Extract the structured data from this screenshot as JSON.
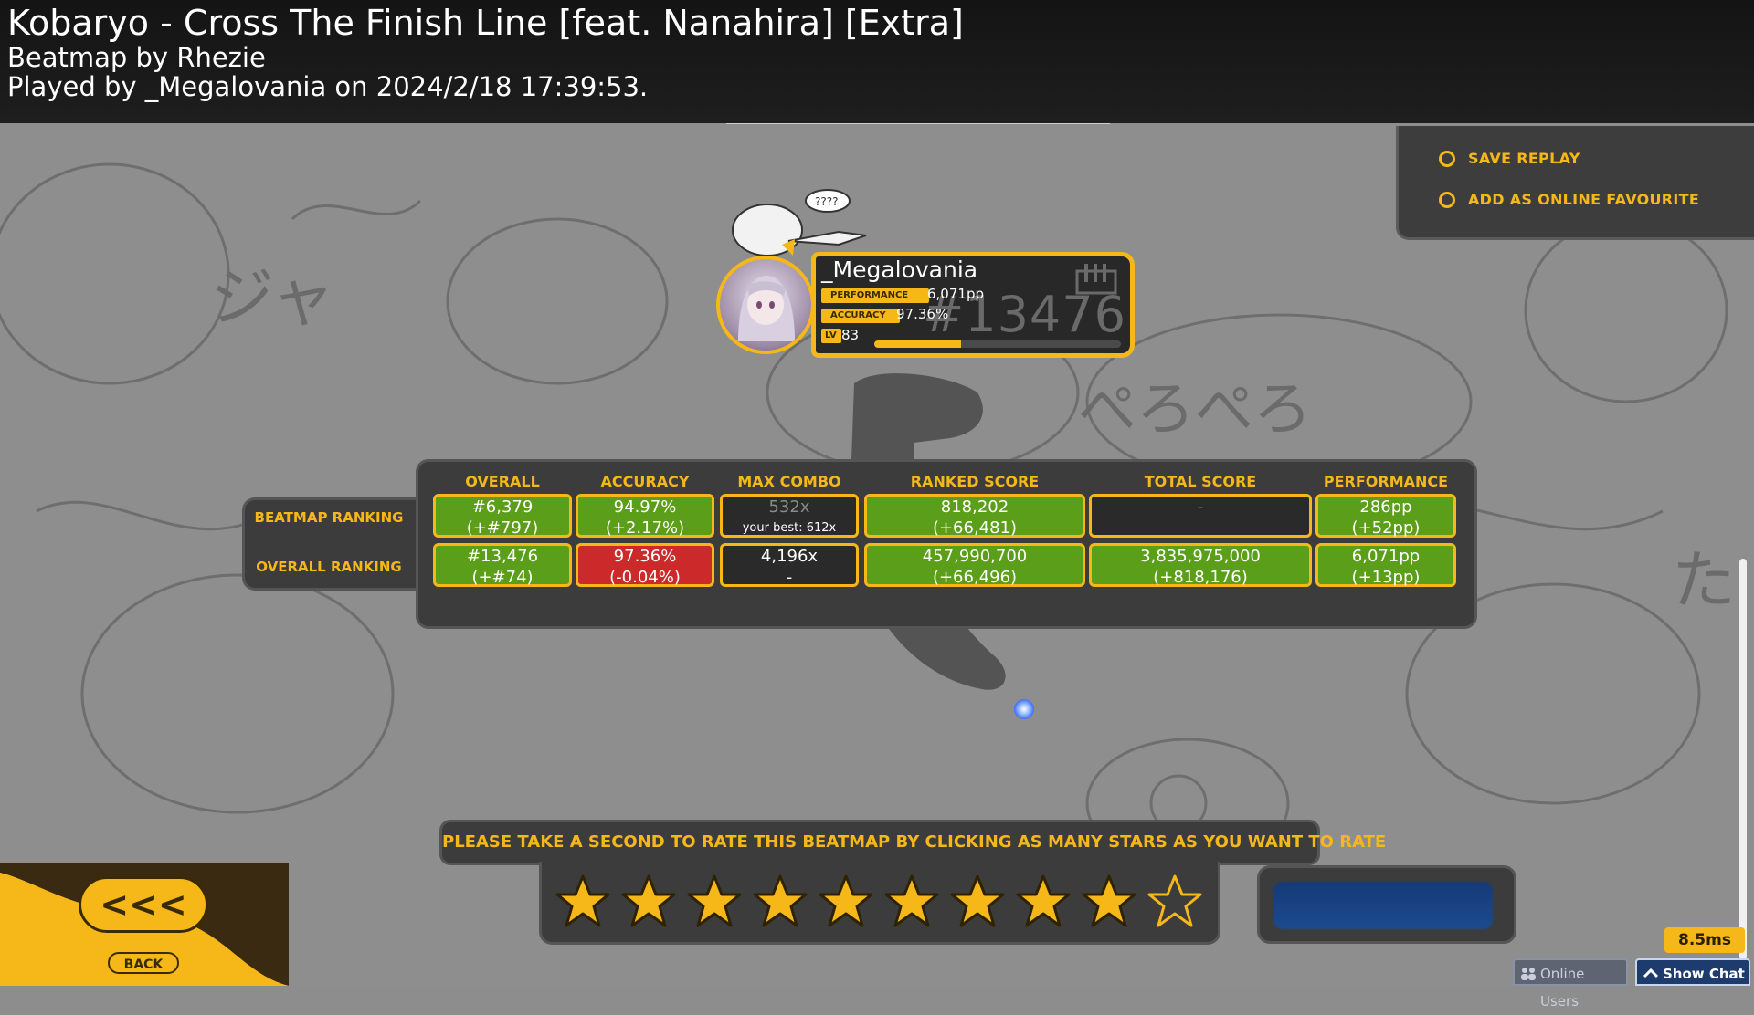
{
  "header": {
    "title": "Kobaryo - Cross The Finish Line [feat. Nanahira] [Extra]",
    "beatmap_by": "Beatmap by Rhezie",
    "played_by": "Played by _Megalovania on 2024/2/18 17:39:53."
  },
  "options": {
    "save_replay": "SAVE REPLAY",
    "add_favourite": "ADD AS ONLINE FAVOURITE"
  },
  "user": {
    "name": "_Megalovania",
    "performance_label": "PERFORMANCE",
    "performance": "6,071pp",
    "accuracy_label": "ACCURACY",
    "accuracy": "97.36%",
    "level_label": "LV",
    "level": "83",
    "rank": "#13476",
    "level_progress": 0.35
  },
  "ranking": {
    "columns": [
      "OVERALL",
      "ACCURACY",
      "MAX COMBO",
      "RANKED SCORE",
      "TOTAL SCORE",
      "PERFORMANCE"
    ],
    "beatmap_label": "BEATMAP RANKING",
    "overall_label": "OVERALL RANKING",
    "beatmap": {
      "overall": [
        "#6,379",
        "(+#797)"
      ],
      "accuracy": [
        "94.97%",
        "(+2.17%)"
      ],
      "max_combo": [
        "532x",
        "your best: 612x"
      ],
      "ranked_score": [
        "818,202",
        "(+66,481)"
      ],
      "total_score": [
        "-",
        ""
      ],
      "performance": [
        "286pp",
        "(+52pp)"
      ]
    },
    "overall": {
      "overall": [
        "#13,476",
        "(+#74)"
      ],
      "accuracy": [
        "97.36%",
        "(-0.04%)"
      ],
      "max_combo": [
        "4,196x",
        "-"
      ],
      "ranked_score": [
        "457,990,700",
        "(+66,496)"
      ],
      "total_score": [
        "3,835,975,000",
        "(+818,176)"
      ],
      "performance": [
        "6,071pp",
        "(+13pp)"
      ]
    }
  },
  "rating": {
    "prompt": "PLEASE TAKE A SECOND TO RATE THIS BEATMAP BY CLICKING AS MANY STARS AS YOU WANT TO RATE",
    "max_stars": 10,
    "filled_stars": 9
  },
  "back": {
    "arrows": "<<<",
    "label": "BACK"
  },
  "status": {
    "latency": "8.5ms",
    "online_users": "Online Users",
    "show_chat": "Show Chat"
  },
  "colors": {
    "accent": "#f5b818",
    "green_cell": "#5b9e19",
    "red_cell": "#cc2a2a",
    "dark_cell": "#2a2a2a"
  }
}
